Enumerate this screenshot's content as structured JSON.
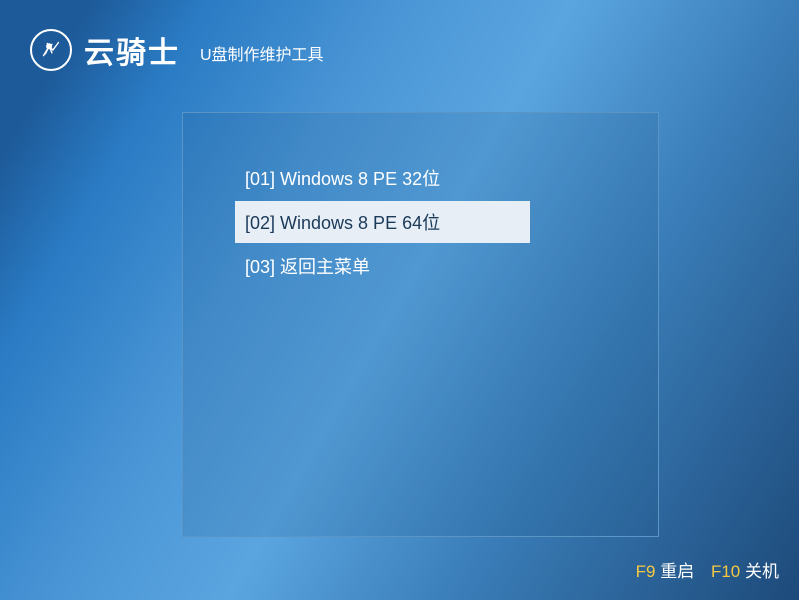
{
  "header": {
    "logo_text": "云骑士",
    "subtitle": "U盘制作维护工具"
  },
  "menu": {
    "items": [
      {
        "label": "[01] Windows 8 PE 32位",
        "selected": false
      },
      {
        "label": "[02] Windows 8 PE 64位",
        "selected": true
      },
      {
        "label": "[03] 返回主菜单",
        "selected": false
      }
    ]
  },
  "footer": {
    "f9_key": "F9",
    "f9_label": "重启",
    "f10_key": "F10",
    "f10_label": "关机"
  }
}
